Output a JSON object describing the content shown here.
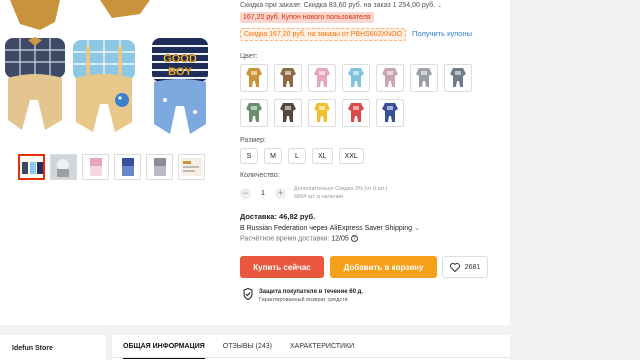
{
  "discounts": {
    "bulk_note": "Скидка при заказе: Скидка 83,60 руб. на заказ 1 254,00 руб.",
    "new_user_pill": "167,20 руб. Купон нового пользователя",
    "coupon_tag": "Скидка 167,20 руб. на заказы от PBHS602XNOO",
    "get_coupons_link": "Получить купоны"
  },
  "color_section": {
    "label": "Цвет:",
    "swatches": [
      {
        "color": "#c9933b",
        "name": "brown-overalls"
      },
      {
        "color": "#8a6a3e",
        "name": "dark-overalls"
      },
      {
        "color": "#e8a7b8",
        "name": "pink-overalls"
      },
      {
        "color": "#7ec3de",
        "name": "blue-overalls"
      },
      {
        "color": "#c9a6b0",
        "name": "mauve-overalls"
      },
      {
        "color": "#9aa0a6",
        "name": "grey-overalls"
      },
      {
        "color": "#6f7a8a",
        "name": "slate-overalls"
      },
      {
        "color": "#6b8f6a",
        "name": "green-overalls"
      },
      {
        "color": "#5a4638",
        "name": "chocolate-overalls"
      },
      {
        "color": "#f0c030",
        "name": "yellow-overalls"
      },
      {
        "color": "#d94a4a",
        "name": "red-stripe-overalls"
      },
      {
        "color": "#3a4f9a",
        "name": "navy-overalls"
      }
    ]
  },
  "size_section": {
    "label": "Размер:",
    "options": [
      "S",
      "M",
      "L",
      "XL",
      "XXL"
    ]
  },
  "quantity_section": {
    "label": "Количество:",
    "minus": "−",
    "value": "1",
    "plus": "+",
    "discount_note": "Дополнительно Скидка 3% (от 6 шт.)",
    "stock_note": "5884 шт. в наличии"
  },
  "shipping": {
    "title": "Доставка: 46,82 руб.",
    "method": "В Russian Federation через AliExpress Saver Shipping",
    "eta_label": "Расчётное время доставки:",
    "eta_value": "12/05"
  },
  "actions": {
    "buy_now": "Купить сейчас",
    "add_to_cart": "Добавить в корзину",
    "wishlist_count": "2681"
  },
  "protection": {
    "title": "Защита покупателя в течение 60 д.",
    "subtitle": "Гарантированный возврат средств"
  },
  "store": {
    "name": "Idefun Store"
  },
  "tabs": [
    {
      "label": "ОБЩАЯ ИНФОРМАЦИЯ",
      "active": true
    },
    {
      "label": "ОТЗЫВЫ (243)",
      "active": false
    },
    {
      "label": "ХАРАКТЕРИСТИКИ",
      "active": false
    }
  ],
  "colors": {
    "accent": "#e62e04",
    "buy": "#e9573e",
    "cart": "#f6a01a",
    "link": "#2e7bd6"
  }
}
